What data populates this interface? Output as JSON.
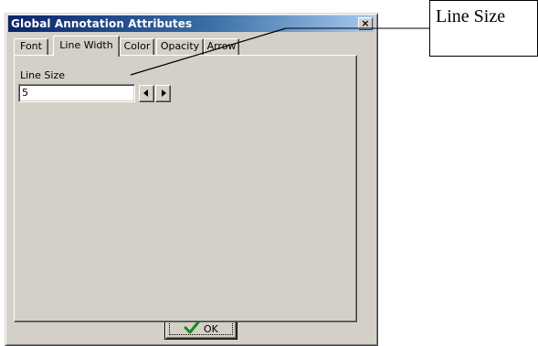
{
  "window": {
    "title": "Global Annotation Attributes",
    "close_glyph": "×"
  },
  "tabs": [
    {
      "label": "Font",
      "active": false
    },
    {
      "label": "Line Width",
      "active": true
    },
    {
      "label": "Color",
      "active": false
    },
    {
      "label": "Opacity",
      "active": false
    },
    {
      "label": "Arrow",
      "active": false
    }
  ],
  "line_width": {
    "label": "Line Size",
    "value": "5"
  },
  "footer": {
    "ok_label": "OK",
    "ok_icon": "checkmark-icon"
  },
  "callout": {
    "text": "Line Size"
  }
}
